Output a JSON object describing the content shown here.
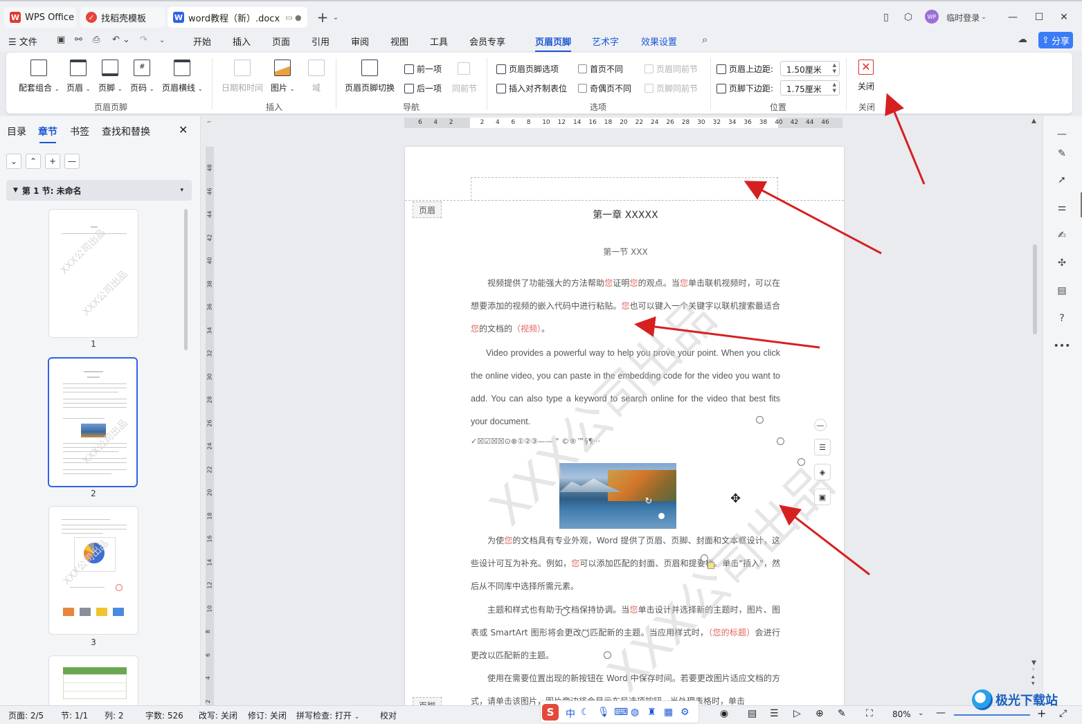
{
  "titlebar": {
    "tabs": [
      {
        "label": "WPS Office"
      },
      {
        "label": "找稻壳模板"
      },
      {
        "label": "word教程（新）.docx"
      }
    ],
    "new_tab": "+",
    "login": "临时登录",
    "avatar_text": "WP"
  },
  "menubar": {
    "file": "文件",
    "items": [
      "开始",
      "插入",
      "页面",
      "引用",
      "审阅",
      "视图",
      "工具",
      "会员专享",
      "页眉页脚",
      "艺术字",
      "效果设置"
    ],
    "active": "页眉页脚",
    "share": "分享"
  },
  "ribbon": {
    "groups": {
      "header_footer": {
        "label": "页眉页脚",
        "buttons": [
          "配套组合",
          "页眉",
          "页脚",
          "页码",
          "页眉横线"
        ]
      },
      "insert": {
        "label": "插入",
        "buttons": [
          "日期和时间",
          "图片",
          "域"
        ]
      },
      "navigation": {
        "label": "导航",
        "switch": "页眉页脚切换",
        "prev": "前一项",
        "next": "后一项",
        "same_as_prev": "同前节"
      },
      "options": {
        "label": "选项",
        "hf_options": "页眉页脚选项",
        "align_tab": "插入对齐制表位",
        "first_page_diff": "首页不同",
        "odd_even_diff": "奇偶页不同",
        "header_same_prev": "页眉同前节",
        "footer_same_prev": "页脚同前节"
      },
      "position": {
        "label": "位置",
        "header_top_label": "页眉上边距:",
        "header_top_value": "1.50厘米",
        "footer_bottom_label": "页脚下边距:",
        "footer_bottom_value": "1.75厘米"
      },
      "close": {
        "label": "关闭",
        "button": "关闭"
      }
    }
  },
  "leftpanel": {
    "tabs": [
      "目录",
      "章节",
      "书签",
      "查找和替换"
    ],
    "active_tab": "章节",
    "section": "第 1 节: 未命名",
    "thumbnails": [
      {
        "num": "1",
        "watermark": "XXX公司出品"
      },
      {
        "num": "2",
        "watermark": "XXX公司出品"
      },
      {
        "num": "3",
        "watermark": "XXX公司出品"
      }
    ]
  },
  "ruler": {
    "h_ticks": [
      "6",
      "4",
      "2",
      "",
      "2",
      "4",
      "6",
      "8",
      "10",
      "12",
      "14",
      "16",
      "18",
      "20",
      "22",
      "24",
      "26",
      "28",
      "30",
      "32",
      "34",
      "36",
      "38",
      "40",
      "42",
      "44",
      "46"
    ],
    "v_ticks": [
      "48",
      "46",
      "44",
      "42",
      "40",
      "38",
      "36",
      "34",
      "32",
      "30",
      "28",
      "26",
      "24",
      "22",
      "20",
      "18",
      "16",
      "14",
      "12",
      "10",
      "8",
      "6",
      "4",
      "2"
    ]
  },
  "document": {
    "header_label": "页眉",
    "footer_label": "页脚",
    "chapter_title": "第一章  XXXXX",
    "section_title": "第一节  XXX",
    "para1_a": "视频提供了功能强大的方法帮助",
    "para1_b": "您",
    "para1_c": "证明",
    "para1_d": "您",
    "para1_e": "的观点。当",
    "para1_f": "您",
    "para1_g": "单击联机视频时，可以在想要添加的视频的嵌入代码中进行粘贴。",
    "para1_h": "您",
    "para1_i": "也可以键入一个关键字以联机搜索最适合",
    "para1_j": "您",
    "para1_k": "的文档的",
    "para1_l": "（视频）",
    "para1_m": "。",
    "para2": "Video provides a powerful way to help you prove your point. When you click the online video, you can paste in the embedding code for the video you want to add. You can also type a keyword to search online for the video that best fits your document.",
    "symbols": "✓☒☑☒☒⊙⊗①②③——   °  ©®™§¶···",
    "para3_a": "为使",
    "para3_b": "您",
    "para3_c": "的文档具有专业外观，Word 提供了页眉、页脚、封面和文本框设计，这些设计可互为补充。例如，",
    "para3_d": "您",
    "para3_e": "可以添加匹配的封面、页眉和提要栏。单击\"插入\"，然后从不同库中选择所需元素。",
    "para4_a": "主题和样式也有助于文档保持协调。当",
    "para4_b": "您",
    "para4_c": "单击设计并选择新的主题时，图片、图表或 SmartArt 图形将会更改以匹配新的主题。当应用样式时，",
    "para4_d": "（您的标题）",
    "para4_e": "会进行更改以匹配新的主题。",
    "para5": "使用在需要位置出现的新按钮在 Word 中保存时间。若要更改图片适应文档的方式，请单击该图片，图片旁边将会显示布局选项按钮。当处理表格时，单击",
    "watermark": "XXX公司出品"
  },
  "statusbar": {
    "page": "页面: 2/5",
    "section": "节: 1/1",
    "column": "列: 2",
    "words": "字数: 526",
    "rewrite": "改写: 关闭",
    "revision": "修订: 关闭",
    "spell": "拼写检查: 打开",
    "proof": "校对",
    "zoom": "80%",
    "ime": "中"
  },
  "colors": {
    "accent": "#1a56d6",
    "share": "#3b7cf6",
    "highlight_text": "#e0655f",
    "annotation_arrow": "#d62020"
  },
  "brand": "极光下载站"
}
